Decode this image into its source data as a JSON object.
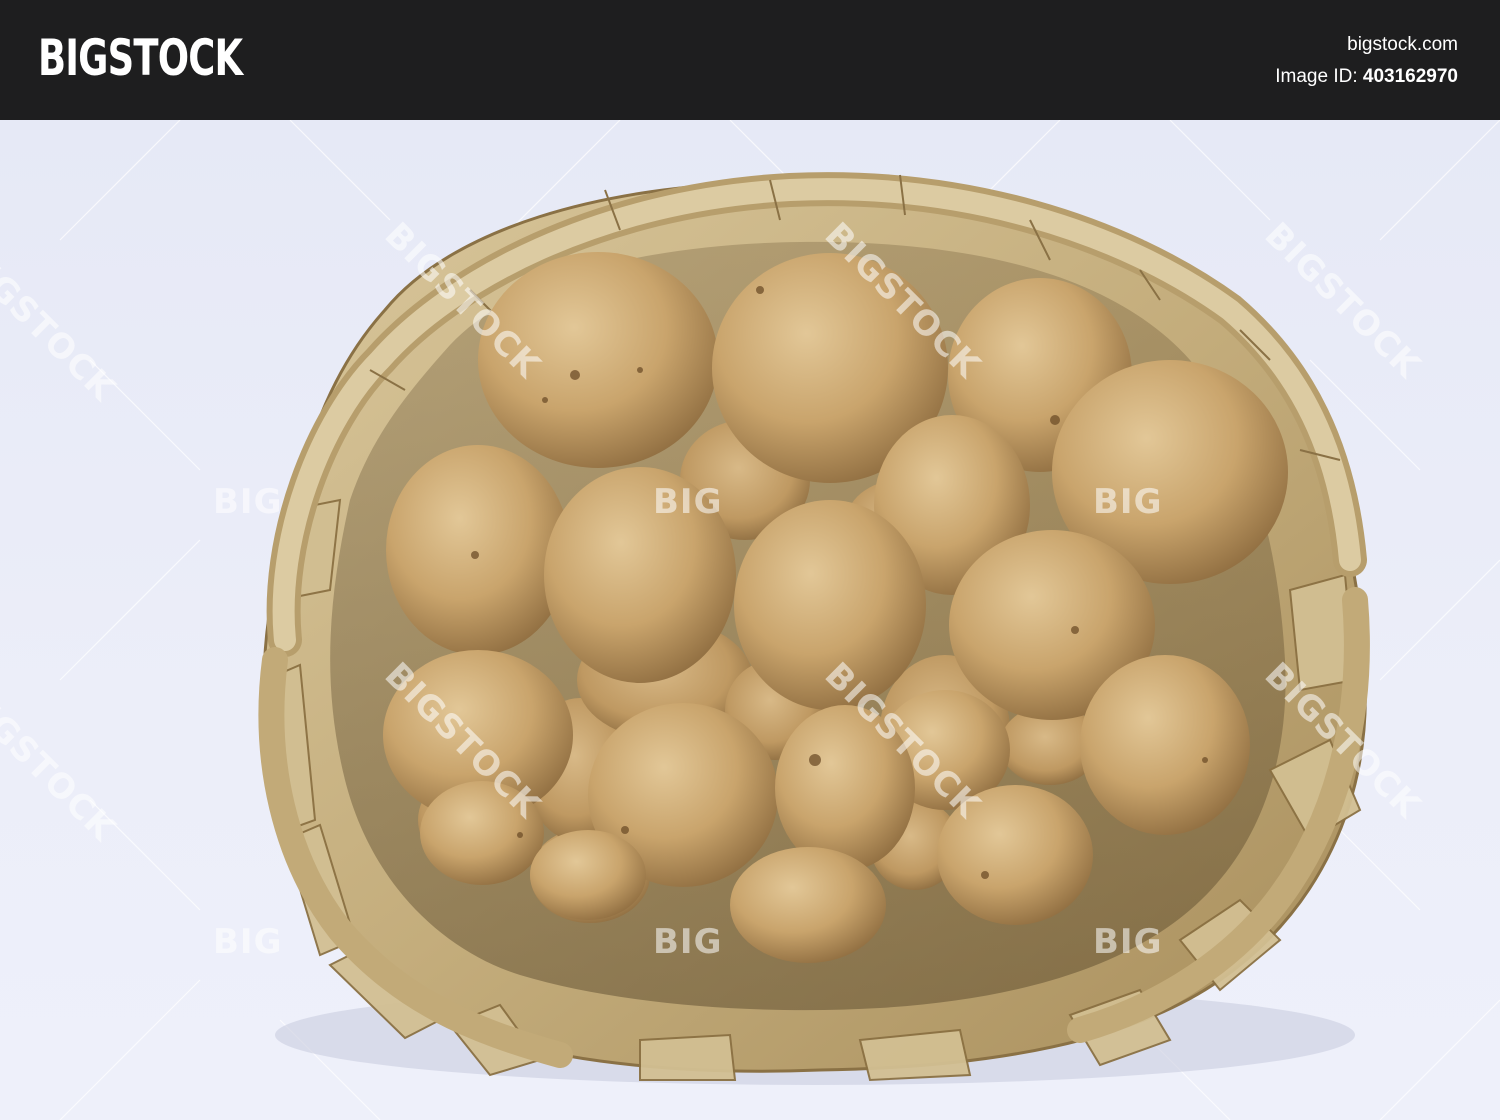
{
  "header": {
    "logo_text": "BIGSTOCK",
    "site": "bigstock.com",
    "image_id_label": "Image ID:",
    "image_id_value": "403162970"
  },
  "watermark": {
    "diagonal_text": "BIGSTOCK",
    "short_text": "BIG"
  },
  "colors": {
    "header_bg": "#1e1e1f",
    "background": "#e9ecf6",
    "potato": "#c9a46c",
    "basket": "#cdb98b"
  }
}
